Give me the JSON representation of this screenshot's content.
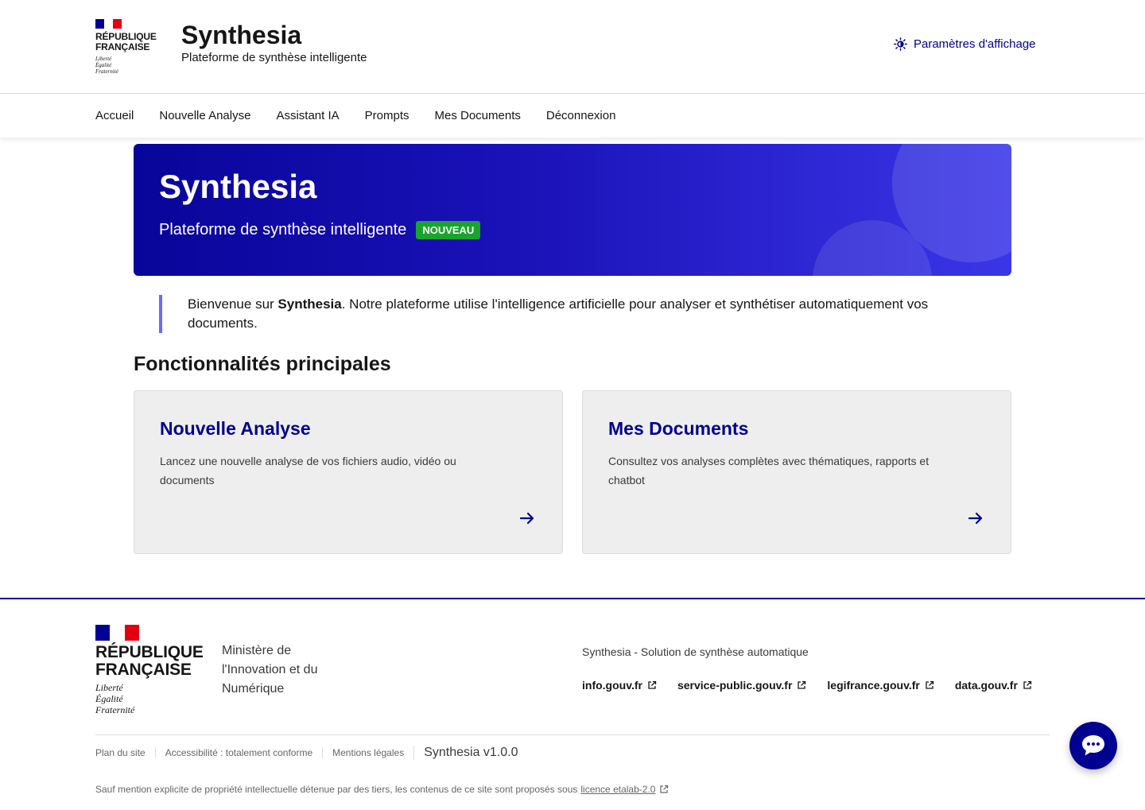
{
  "header": {
    "rf_name_line1": "République",
    "rf_name_line2": "Française",
    "rf_motto_1": "Liberté",
    "rf_motto_2": "Égalité",
    "rf_motto_3": "Fraternité",
    "title": "Synthesia",
    "tagline": "Plateforme de synthèse intelligente",
    "display_settings": {
      "label": "Paramètres d'affichage",
      "icon": "sun-icon"
    }
  },
  "nav": {
    "items": [
      {
        "label": "Accueil"
      },
      {
        "label": "Nouvelle Analyse"
      },
      {
        "label": "Assistant IA"
      },
      {
        "label": "Prompts"
      },
      {
        "label": "Mes Documents"
      },
      {
        "label": "Déconnexion"
      }
    ]
  },
  "hero": {
    "title": "Synthesia",
    "subtitle": "Plateforme de synthèse intelligente",
    "badge": "Nouveau"
  },
  "welcome": {
    "prefix": "Bienvenue sur ",
    "strong": "Synthesia",
    "suffix": ". Notre plateforme utilise l'intelligence artificielle pour analyser et synthétiser automatiquement vos documents."
  },
  "features": {
    "title": "Fonctionnalités principales",
    "cards": [
      {
        "title": "Nouvelle Analyse",
        "description": "Lancez une nouvelle analyse de vos fichiers audio, vidéo ou documents",
        "icon": "arrow-right-icon"
      },
      {
        "title": "Mes Documents",
        "description": "Consultez vos analyses complètes avec thématiques, rapports et chatbot",
        "icon": "arrow-right-icon"
      }
    ]
  },
  "footer": {
    "rf_name_line1": "République",
    "rf_name_line2": "Française",
    "rf_motto_1": "Liberté",
    "rf_motto_2": "Égalité",
    "rf_motto_3": "Fraternité",
    "ministry_alt": "Ministère de l'Innovation et du Numérique",
    "description": "Synthesia - Solution de synthèse automatique",
    "links": [
      {
        "label": "info.gouv.fr"
      },
      {
        "label": "service-public.gouv.fr"
      },
      {
        "label": "legifrance.gouv.fr"
      },
      {
        "label": "data.gouv.fr"
      }
    ],
    "bottom_links": [
      {
        "label": "Plan du site"
      },
      {
        "label": "Accessibilité : totalement conforme"
      },
      {
        "label": "Mentions légales"
      }
    ],
    "version": "Synthesia v1.0.0",
    "license_text": "Sauf mention explicite de propriété intellectuelle détenue par des tiers, les contenus de ce site sont proposés sous",
    "license_link": "licence etalab-2.0"
  },
  "chat": {
    "icon": "chat-bubble-icon"
  },
  "colors": {
    "brand_blue": "#000091",
    "accent_purple": "#6a6af4",
    "badge_green": "#18a52b",
    "marianne_red": "#e1000f"
  }
}
